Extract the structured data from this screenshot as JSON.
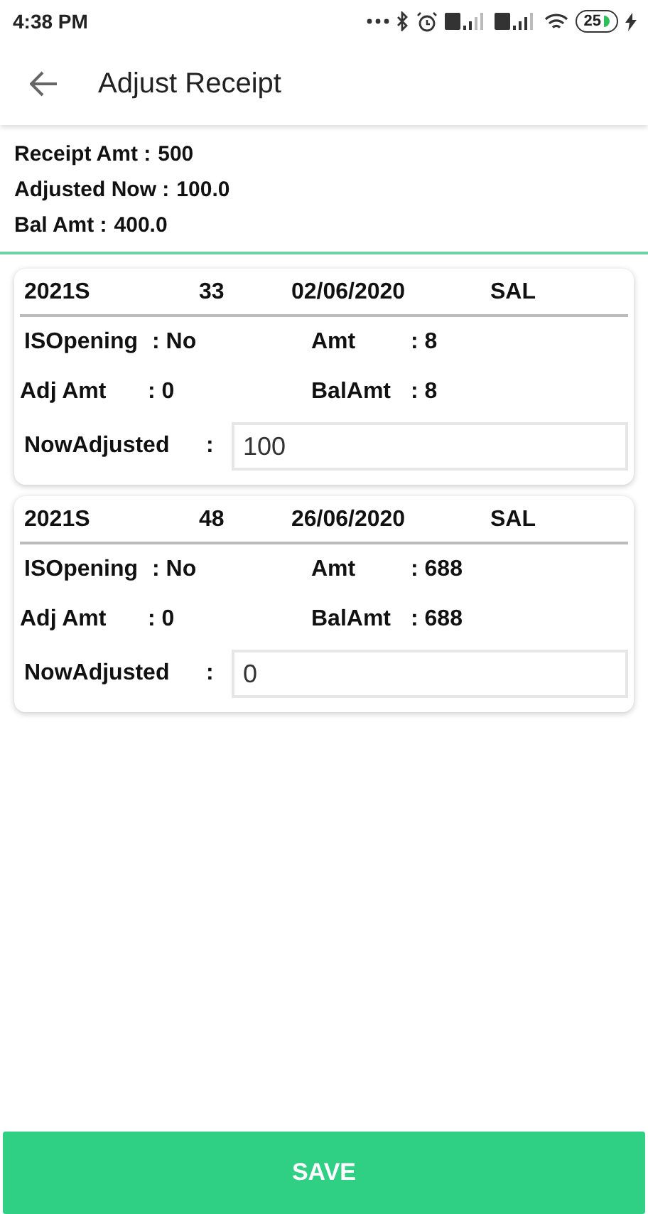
{
  "status_bar": {
    "time": "4:38 PM",
    "battery": "25"
  },
  "app_bar": {
    "title": "Adjust Receipt"
  },
  "summary": [
    {
      "label": "Receipt Amt :",
      "value": "500"
    },
    {
      "label": "Adjusted Now :",
      "value": "100.0"
    },
    {
      "label": "Bal Amt :",
      "value": "400.0"
    }
  ],
  "entries": [
    {
      "header": [
        "2021S",
        "33",
        "02/06/2020",
        "SAL"
      ],
      "is_opening": {
        "label": "ISOpening",
        "value": ": No"
      },
      "amt": {
        "label": "Amt",
        "value": ": 8"
      },
      "adj_amt": {
        "label": "Adj Amt",
        "value": ": 0"
      },
      "bal_amt": {
        "label": "BalAmt",
        "value": ": 8"
      },
      "now_adjusted": {
        "label": "NowAdjusted",
        "colon": ":",
        "value": "100"
      }
    },
    {
      "header": [
        "2021S",
        "48",
        "26/06/2020",
        "SAL"
      ],
      "is_opening": {
        "label": "ISOpening",
        "value": ": No"
      },
      "amt": {
        "label": "Amt",
        "value": ": 688"
      },
      "adj_amt": {
        "label": "Adj Amt",
        "value": ": 0"
      },
      "bal_amt": {
        "label": "BalAmt",
        "value": ": 688"
      },
      "now_adjusted": {
        "label": "NowAdjusted",
        "colon": ":",
        "value": "0"
      }
    }
  ],
  "save_button": {
    "label": "SAVE"
  }
}
